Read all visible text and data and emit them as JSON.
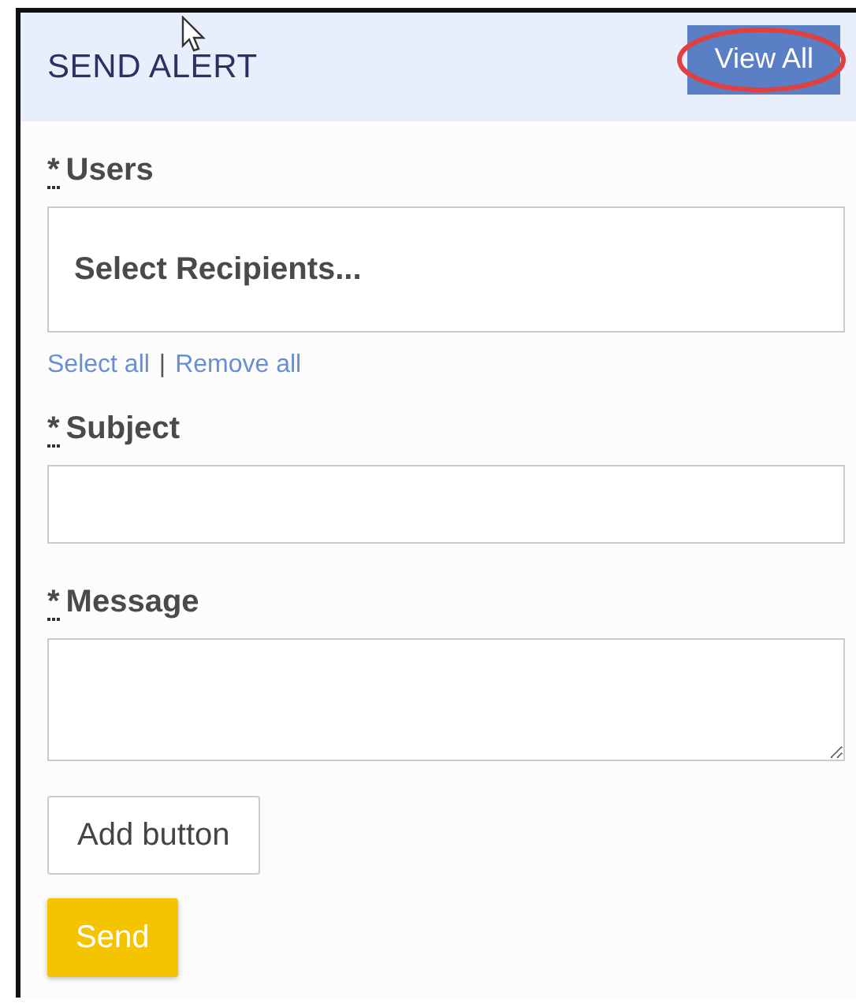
{
  "panel": {
    "title": "SEND ALERT",
    "header_button": {
      "label": "View All",
      "highlighted": true
    }
  },
  "fields": [
    {
      "kind": "multiselect",
      "required_mark": "*",
      "label": "Users",
      "placeholder": "Select Recipients..."
    },
    {
      "kind": "text",
      "required_mark": "*",
      "label": "Subject"
    },
    {
      "kind": "textarea",
      "required_mark": "*",
      "label": "Message"
    }
  ],
  "recipient_links": {
    "select_all": "Select all",
    "separator": "|",
    "remove_all": "Remove all"
  },
  "buttons": [
    {
      "kind": "secondary",
      "label": "Add button"
    },
    {
      "kind": "primary",
      "label": "Send"
    }
  ]
}
